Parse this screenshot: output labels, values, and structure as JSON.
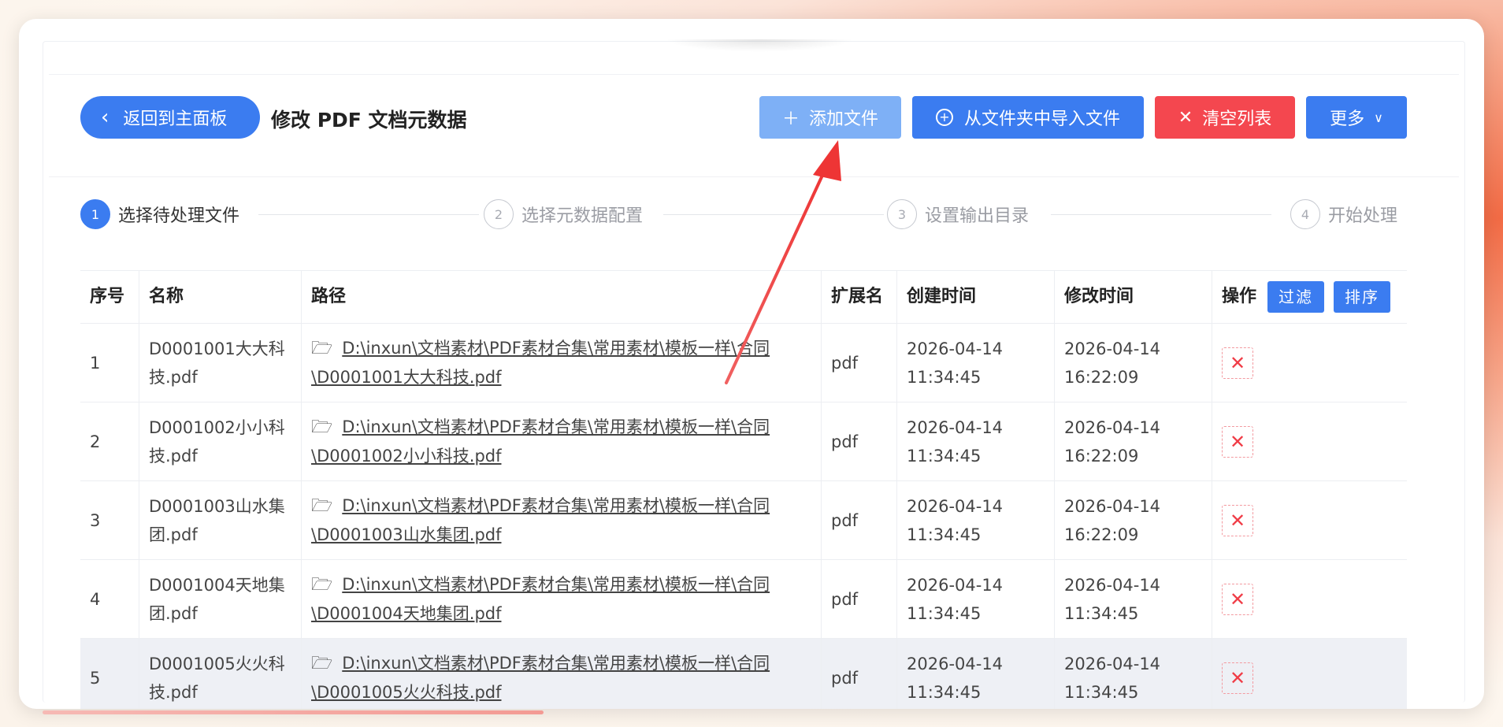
{
  "header": {
    "back_label": "返回到主面板",
    "title": "修改 PDF 文档元数据",
    "buttons": {
      "add": "添加文件",
      "import": "从文件夹中导入文件",
      "clear": "清空列表",
      "more": "更多"
    }
  },
  "steps": [
    {
      "num": "1",
      "label": "选择待处理文件",
      "active": true
    },
    {
      "num": "2",
      "label": "选择元数据配置",
      "active": false
    },
    {
      "num": "3",
      "label": "设置输出目录",
      "active": false
    },
    {
      "num": "4",
      "label": "开始处理",
      "active": false
    }
  ],
  "table": {
    "columns": [
      "序号",
      "名称",
      "路径",
      "扩展名",
      "创建时间",
      "修改时间",
      "操作"
    ],
    "filter_label": "过滤",
    "sort_label": "排序",
    "rows": [
      {
        "index": "1",
        "name": "D0001001大大科技.pdf",
        "path": "D:\\inxun\\文档素材\\PDF素材合集\\常用素材\\模板一样\\合同\\D0001001大大科技.pdf",
        "ext": "pdf",
        "created": "2026-04-14 11:34:45",
        "modified": "2026-04-14 16:22:09"
      },
      {
        "index": "2",
        "name": "D0001002小小科技.pdf",
        "path": "D:\\inxun\\文档素材\\PDF素材合集\\常用素材\\模板一样\\合同\\D0001002小小科技.pdf",
        "ext": "pdf",
        "created": "2026-04-14 11:34:45",
        "modified": "2026-04-14 16:22:09"
      },
      {
        "index": "3",
        "name": "D0001003山水集团.pdf",
        "path": "D:\\inxun\\文档素材\\PDF素材合集\\常用素材\\模板一样\\合同\\D0001003山水集团.pdf",
        "ext": "pdf",
        "created": "2026-04-14 11:34:45",
        "modified": "2026-04-14 16:22:09"
      },
      {
        "index": "4",
        "name": "D0001004天地集团.pdf",
        "path": "D:\\inxun\\文档素材\\PDF素材合集\\常用素材\\模板一样\\合同\\D0001004天地集团.pdf",
        "ext": "pdf",
        "created": "2026-04-14 11:34:45",
        "modified": "2026-04-14 11:34:45"
      },
      {
        "index": "5",
        "name": "D0001005火火科技.pdf",
        "path": "D:\\inxun\\文档素材\\PDF素材合集\\常用素材\\模板一样\\合同\\D0001005火火科技.pdf",
        "ext": "pdf",
        "created": "2026-04-14 11:34:45",
        "modified": "2026-04-14 11:34:45"
      }
    ],
    "highlighted_row": 4
  },
  "colors": {
    "primary": "#3b7cf0",
    "primary_light": "#7eb0f6",
    "danger": "#f4474f",
    "annotation_arrow": "#ee3d3d"
  },
  "icons": {
    "back": "chevron-left-icon",
    "add": "plus-icon",
    "import": "circle-plus-icon",
    "clear": "close-icon",
    "more": "chevron-down-icon",
    "path": "folder-open-icon",
    "delete": "close-icon"
  }
}
